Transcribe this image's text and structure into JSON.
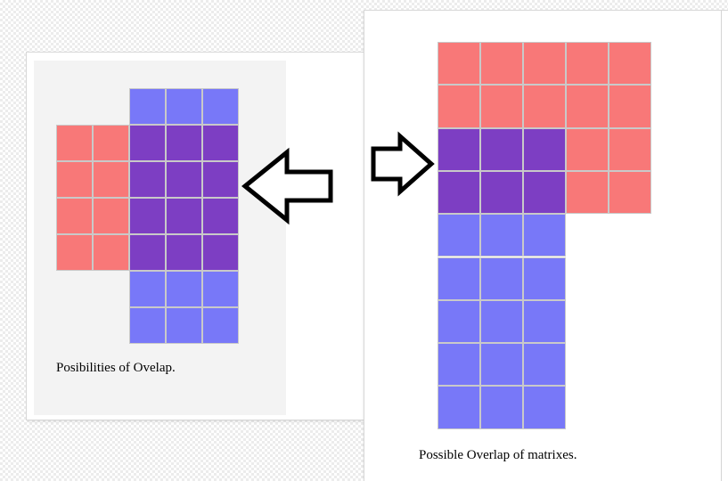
{
  "colors": {
    "red_block": "#f87878",
    "blue_block": "#7878f8",
    "overlap": "#7d3ec3",
    "arrow_stroke": "#000000",
    "arrow_fill": "#ffffff"
  },
  "left_figure": {
    "caption": "Posibilities of Ovelap.",
    "red_matrix": {
      "rows": 4,
      "cols": 2
    },
    "blue_matrix": {
      "rows": 7,
      "cols": 3
    },
    "overlap": {
      "rows": 4,
      "cols": 3
    }
  },
  "right_figure": {
    "caption": "Possible Overlap of matrixes.",
    "red_matrix": {
      "rows": 4,
      "cols": 5
    },
    "blue_matrix": {
      "rows": 7,
      "cols": 3
    },
    "overlap": {
      "rows": 2,
      "cols": 3
    }
  },
  "arrows": {
    "left": "left-arrow-icon",
    "right": "right-arrow-icon"
  }
}
